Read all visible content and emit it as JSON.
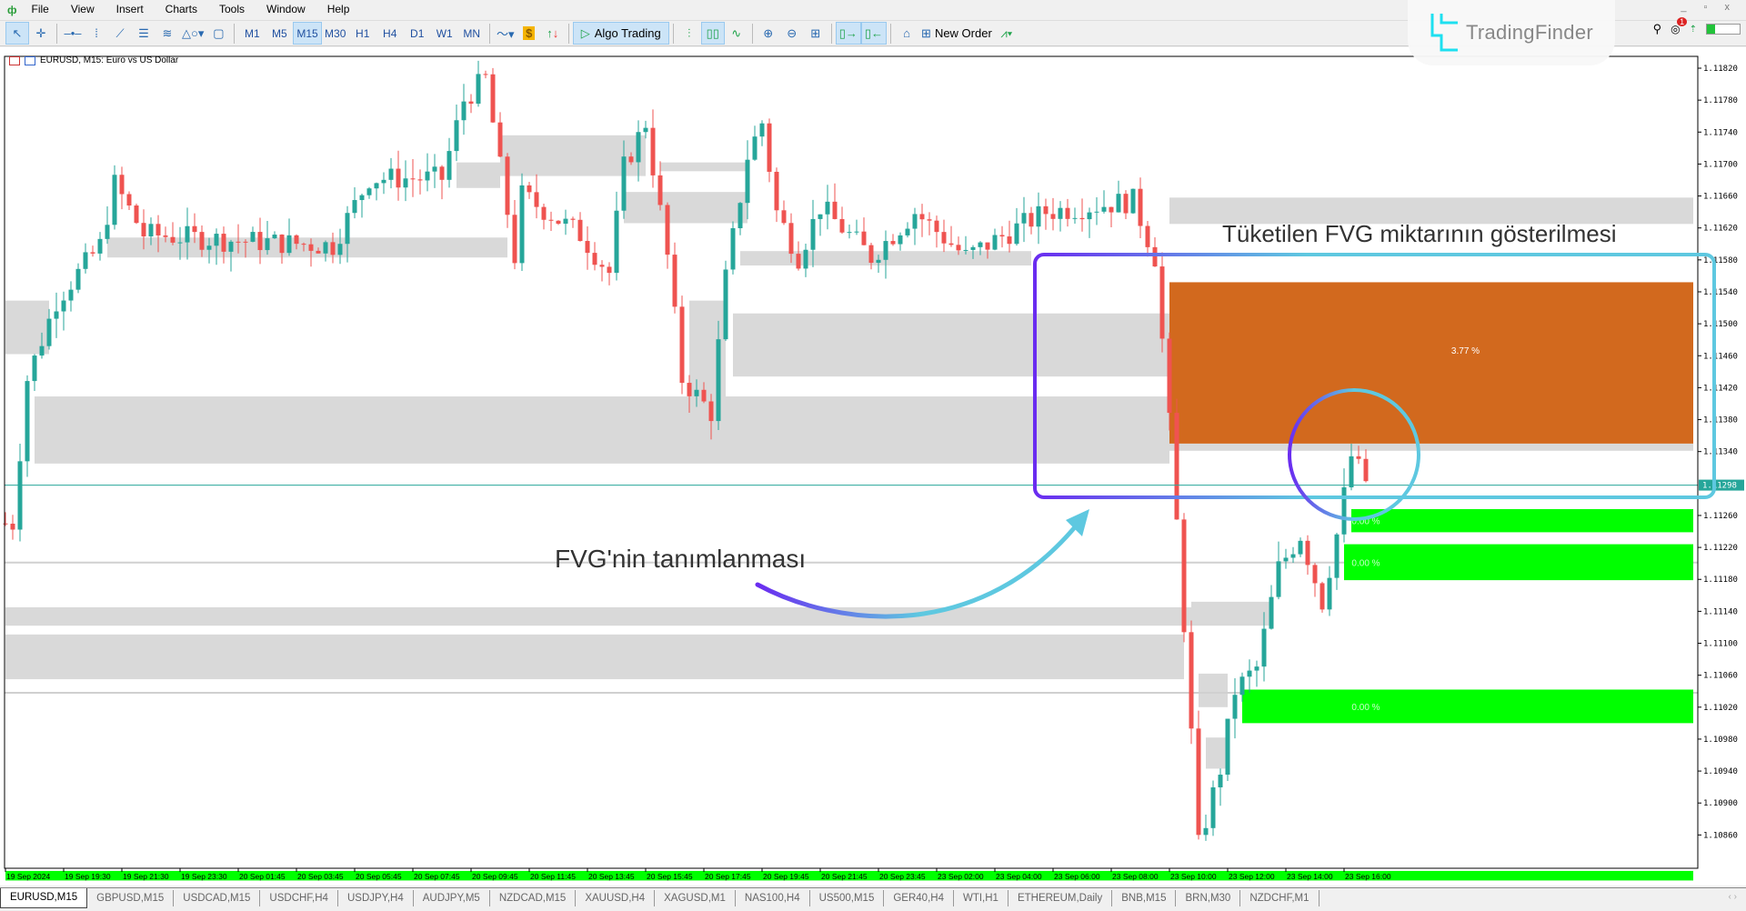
{
  "menu": {
    "items": [
      "File",
      "View",
      "Insert",
      "Charts",
      "Tools",
      "Window",
      "Help"
    ]
  },
  "toolbar": {
    "timeframes": [
      "M1",
      "M5",
      "M15",
      "M30",
      "H1",
      "H4",
      "D1",
      "W1",
      "MN"
    ],
    "active_timeframe": "M15",
    "algo_trading": "Algo Trading",
    "new_order": "New Order"
  },
  "brand": {
    "logo_text": "TradingFinder"
  },
  "notifications": {
    "count": "1"
  },
  "chart": {
    "title": "EURUSD, M15:  Euro vs US Dollar",
    "symbol": "EURUSD",
    "current_price": "1.11298",
    "price_ticks": [
      "1.11820",
      "1.11780",
      "1.11740",
      "1.11700",
      "1.11660",
      "1.11620",
      "1.11580",
      "1.11540",
      "1.11500",
      "1.11460",
      "1.11420",
      "1.11380",
      "1.11340",
      "1.11260",
      "1.11220",
      "1.11180",
      "1.11140",
      "1.11100",
      "1.11060",
      "1.11020",
      "1.10980",
      "1.10940",
      "1.10900",
      "1.10860"
    ],
    "time_labels": [
      "19 Sep 2024",
      "19 Sep 19:30",
      "19 Sep 21:30",
      "19 Sep 23:30",
      "20 Sep 01:45",
      "20 Sep 03:45",
      "20 Sep 05:45",
      "20 Sep 07:45",
      "20 Sep 09:45",
      "20 Sep 11:45",
      "20 Sep 13:45",
      "20 Sep 15:45",
      "20 Sep 17:45",
      "20 Sep 19:45",
      "20 Sep 21:45",
      "20 Sep 23:45",
      "23 Sep 02:00",
      "23 Sep 04:00",
      "23 Sep 06:00",
      "23 Sep 08:00",
      "23 Sep 10:00",
      "23 Sep 12:00",
      "23 Sep 14:00",
      "23 Sep 16:00"
    ],
    "colors": {
      "bull": "#26a69a",
      "bear": "#ef5350",
      "fvg_zone": "#d9d9d9",
      "fvg_partial": "#d2691e",
      "fvg_fresh": "#00ff00",
      "price_line": "#26a69a"
    },
    "price_path": [
      [
        0,
        1.1125
      ],
      [
        1,
        1.1125
      ],
      [
        3,
        1.11431
      ],
      [
        7,
        1.11529
      ],
      [
        13,
        1.11598
      ],
      [
        15,
        1.11675
      ],
      [
        19,
        1.11612
      ],
      [
        30,
        1.11605
      ],
      [
        45,
        1.11598
      ],
      [
        50,
        1.11682
      ],
      [
        60,
        1.11682
      ],
      [
        63,
        1.1178
      ],
      [
        66,
        1.11807
      ],
      [
        70,
        1.11584
      ],
      [
        71,
        1.11661
      ],
      [
        79,
        1.11612
      ],
      [
        83,
        1.11564
      ],
      [
        85,
        1.11696
      ],
      [
        88,
        1.11752
      ],
      [
        91,
        1.11584
      ],
      [
        93,
        1.11431
      ],
      [
        97,
        1.11389
      ],
      [
        99,
        1.11557
      ],
      [
        102,
        1.1171
      ],
      [
        104,
        1.11752
      ],
      [
        106,
        1.1164
      ],
      [
        109,
        1.11584
      ],
      [
        112,
        1.11647
      ],
      [
        119,
        1.11584
      ],
      [
        125,
        1.1164
      ],
      [
        132,
        1.11584
      ],
      [
        143,
        1.1164
      ],
      [
        155,
        1.11654
      ],
      [
        158,
        1.11584
      ],
      [
        160,
        1.11375
      ],
      [
        161,
        1.1125
      ],
      [
        162,
        1.11125
      ],
      [
        164,
        1.10846
      ],
      [
        167,
        1.10943
      ],
      [
        169,
        1.11041
      ],
      [
        172,
        1.11069
      ],
      [
        175,
        1.11194
      ],
      [
        178,
        1.11236
      ],
      [
        181,
        1.11152
      ],
      [
        183,
        1.11236
      ],
      [
        185,
        1.11334
      ],
      [
        187,
        1.11303
      ]
    ],
    "fvg_zones": [
      {
        "from": 0,
        "to": 6,
        "top": 1.11529,
        "bottom": 1.11462
      },
      {
        "from": 4,
        "to": 160,
        "top": 1.11409,
        "bottom": 1.11325
      },
      {
        "from": 14,
        "to": 69,
        "top": 1.11608,
        "bottom": 1.11583
      },
      {
        "from": 62,
        "to": 68,
        "top": 1.11702,
        "bottom": 1.1167
      },
      {
        "from": 68,
        "to": 88,
        "top": 1.11736,
        "bottom": 1.11685
      },
      {
        "from": 85,
        "to": 102,
        "top": 1.11665,
        "bottom": 1.11626
      },
      {
        "from": 90,
        "to": 102,
        "top": 1.11702,
        "bottom": 1.11691
      },
      {
        "from": 94,
        "to": 99,
        "top": 1.11529,
        "bottom": 1.11403
      },
      {
        "from": 100,
        "to": 160,
        "top": 1.11513,
        "bottom": 1.11434
      },
      {
        "from": 101,
        "to": 141,
        "top": 1.11591,
        "bottom": 1.11573
      },
      {
        "from": 160,
        "to": 232,
        "top": 1.11658,
        "bottom": 1.11625
      },
      {
        "from": 0,
        "to": 174,
        "top": 1.11145,
        "bottom": 1.11122
      },
      {
        "from": 0,
        "to": 162,
        "top": 1.11111,
        "bottom": 1.11055
      },
      {
        "from": 163,
        "to": 174,
        "top": 1.11152,
        "bottom": 1.11124
      },
      {
        "from": 164,
        "to": 168,
        "top": 1.11062,
        "bottom": 1.1102
      },
      {
        "from": 165,
        "to": 168,
        "top": 1.10982,
        "bottom": 1.10943
      },
      {
        "from": 160,
        "to": 232,
        "top": 1.1135,
        "bottom": 1.11341
      }
    ],
    "fvg_lines": [
      1.11201,
      1.11038
    ],
    "fvg_partial": [
      {
        "from": 160,
        "to": 232,
        "top": 1.11552,
        "bottom": 1.1135,
        "label": "3.77 %"
      }
    ],
    "fvg_fresh": [
      {
        "from": 185,
        "to": 232,
        "top": 1.11268,
        "bottom": 1.11239,
        "label": "0.00 %"
      },
      {
        "from": 184,
        "to": 232,
        "top": 1.11224,
        "bottom": 1.11179,
        "label": "0.00 %"
      },
      {
        "from": 170,
        "to": 232,
        "top": 1.11042,
        "bottom": 1.11,
        "label": "0.00 %"
      },
      {
        "from": 0,
        "to": 232,
        "top": 1.10815,
        "bottom": 1.10803,
        "label": ""
      }
    ]
  },
  "annotations": {
    "definition": "FVG'nin tanımlanması",
    "consumed": "Tüketilen FVG miktarının gösterilmesi"
  },
  "tabs": [
    "EURUSD,M15",
    "GBPUSD,M15",
    "USDCAD,M15",
    "USDCHF,H4",
    "USDJPY,H4",
    "AUDJPY,M5",
    "NZDCAD,M15",
    "XAUUSD,H4",
    "XAGUSD,M1",
    "NAS100,H4",
    "US500,M15",
    "GER40,H4",
    "WTI,H1",
    "ETHEREUM,Daily",
    "BNB,M15",
    "BRN,M30",
    "NZDCHF,M1"
  ],
  "active_tab": "EURUSD,M15"
}
